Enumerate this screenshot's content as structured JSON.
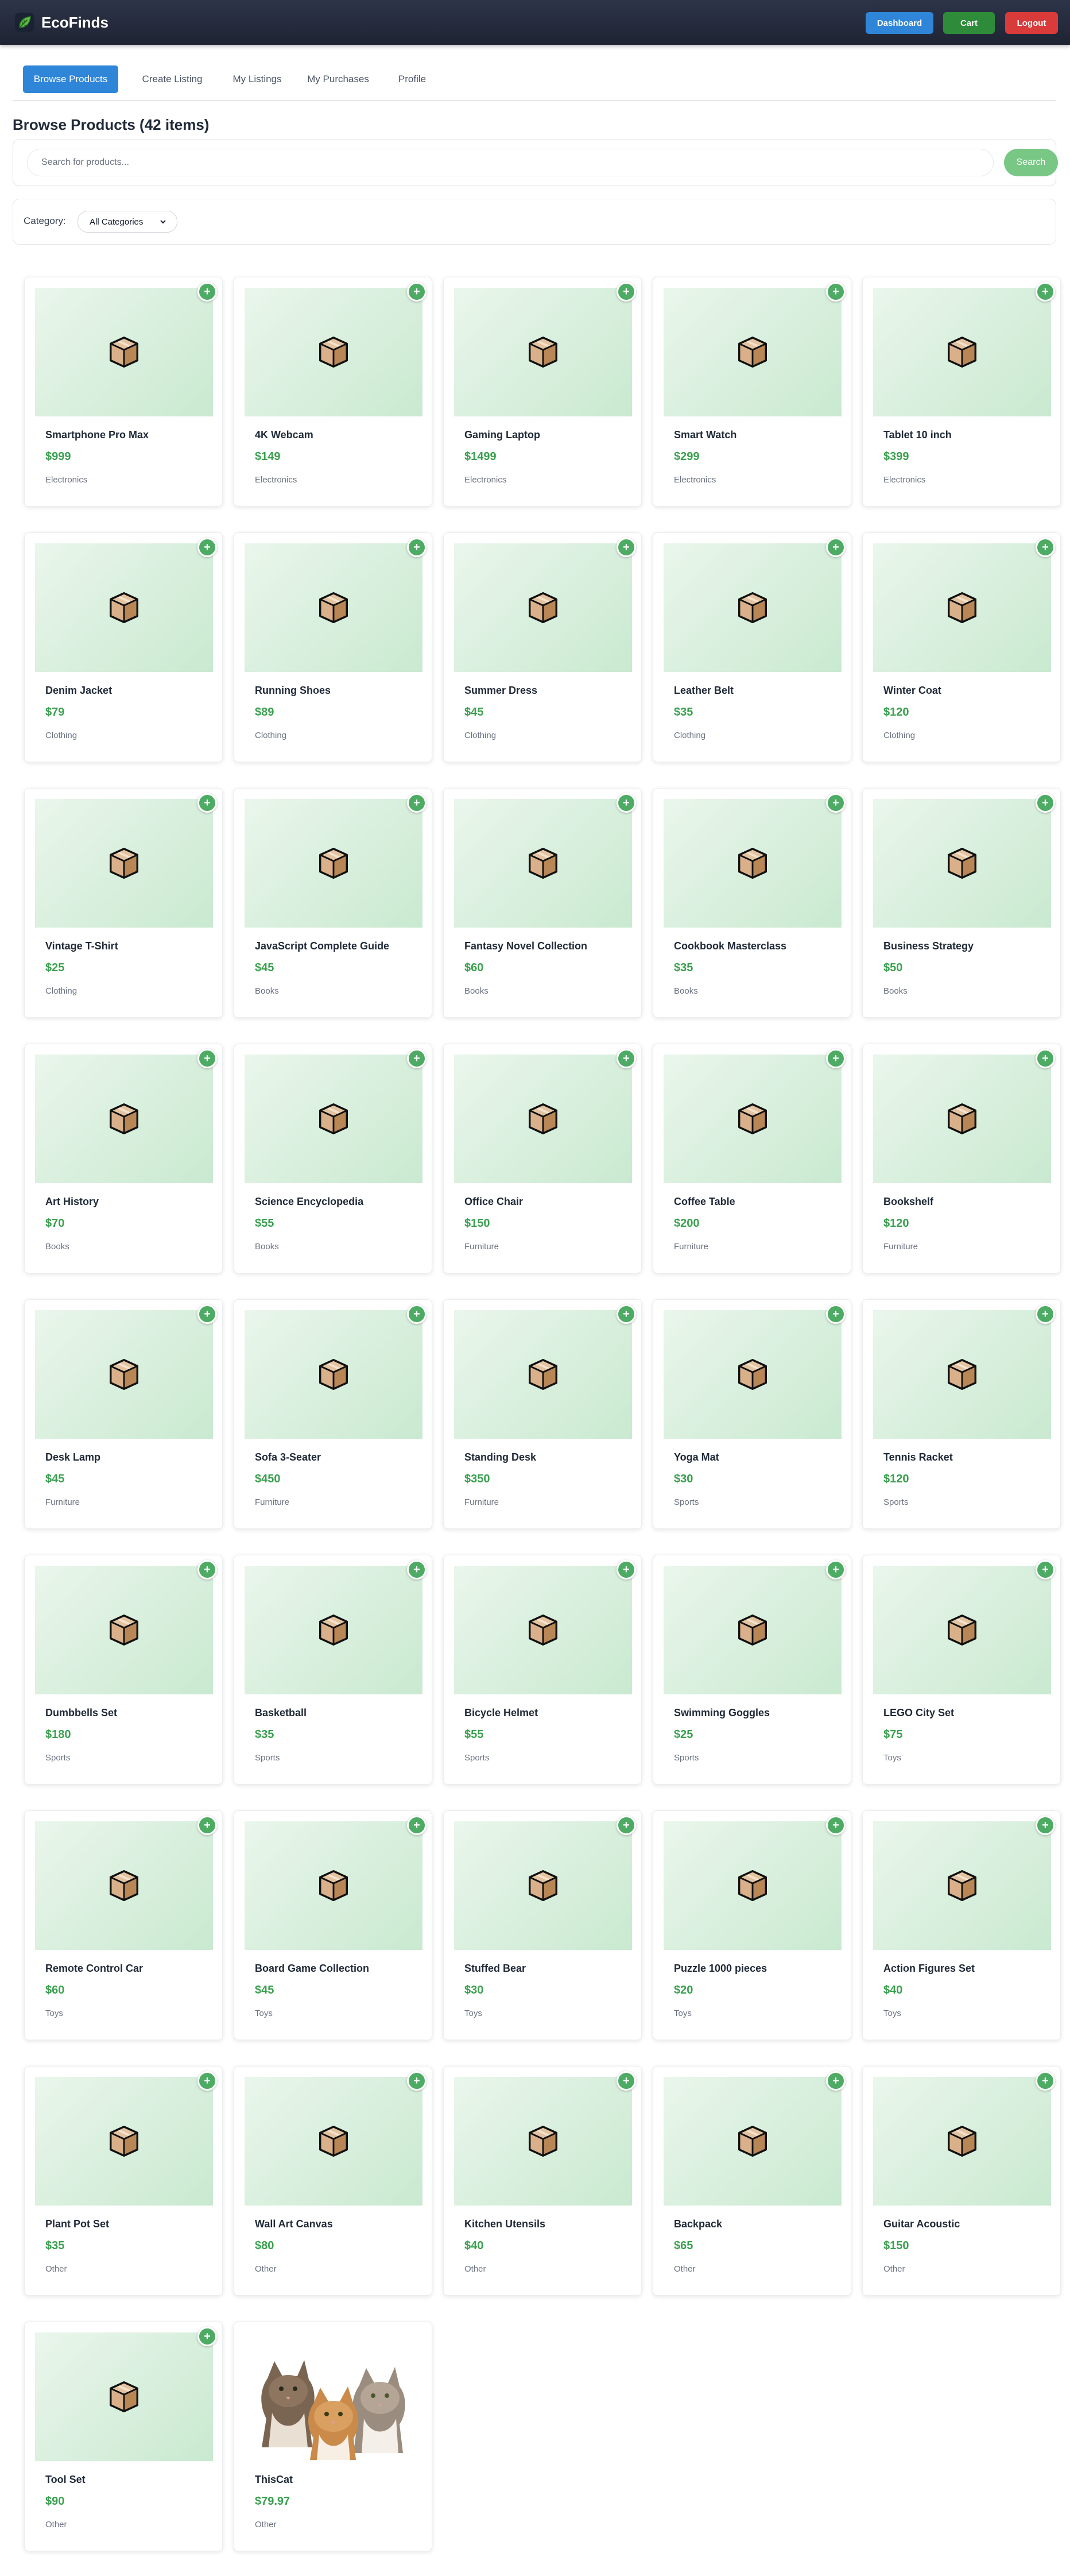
{
  "app": {
    "name": "EcoFinds"
  },
  "header": {
    "dashboard_label": "Dashboard",
    "cart_label": "Cart",
    "logout_label": "Logout"
  },
  "tabs": [
    {
      "label": "Browse Products",
      "active": true
    },
    {
      "label": "Create Listing",
      "active": false
    },
    {
      "label": "My Listings",
      "active": false
    },
    {
      "label": "My Purchases",
      "active": false
    },
    {
      "label": "Profile",
      "active": false
    }
  ],
  "page": {
    "title": "Browse Products (42 items)"
  },
  "search": {
    "placeholder": "Search for products...",
    "button_label": "Search"
  },
  "filter": {
    "label": "Category:",
    "selected": "All Categories"
  },
  "colors": {
    "accent_blue": "#2f86d8",
    "cart_green": "#2e8b3a",
    "logout_red": "#d93a3a",
    "price_green": "#3aa04f"
  },
  "products": [
    {
      "name": "Smartphone Pro Max",
      "price": "$999",
      "category": "Electronics",
      "image": "box-icon"
    },
    {
      "name": "4K Webcam",
      "price": "$149",
      "category": "Electronics",
      "image": "box-icon"
    },
    {
      "name": "Gaming Laptop",
      "price": "$1499",
      "category": "Electronics",
      "image": "box-icon"
    },
    {
      "name": "Smart Watch",
      "price": "$299",
      "category": "Electronics",
      "image": "box-icon"
    },
    {
      "name": "Tablet 10 inch",
      "price": "$399",
      "category": "Electronics",
      "image": "box-icon"
    },
    {
      "name": "Denim Jacket",
      "price": "$79",
      "category": "Clothing",
      "image": "box-icon"
    },
    {
      "name": "Running Shoes",
      "price": "$89",
      "category": "Clothing",
      "image": "box-icon"
    },
    {
      "name": "Summer Dress",
      "price": "$45",
      "category": "Clothing",
      "image": "box-icon"
    },
    {
      "name": "Leather Belt",
      "price": "$35",
      "category": "Clothing",
      "image": "box-icon"
    },
    {
      "name": "Winter Coat",
      "price": "$120",
      "category": "Clothing",
      "image": "box-icon"
    },
    {
      "name": "Vintage T-Shirt",
      "price": "$25",
      "category": "Clothing",
      "image": "box-icon"
    },
    {
      "name": "JavaScript Complete Guide",
      "price": "$45",
      "category": "Books",
      "image": "box-icon"
    },
    {
      "name": "Fantasy Novel Collection",
      "price": "$60",
      "category": "Books",
      "image": "box-icon"
    },
    {
      "name": "Cookbook Masterclass",
      "price": "$35",
      "category": "Books",
      "image": "box-icon"
    },
    {
      "name": "Business Strategy",
      "price": "$50",
      "category": "Books",
      "image": "box-icon"
    },
    {
      "name": "Art History",
      "price": "$70",
      "category": "Books",
      "image": "box-icon"
    },
    {
      "name": "Science Encyclopedia",
      "price": "$55",
      "category": "Books",
      "image": "box-icon"
    },
    {
      "name": "Office Chair",
      "price": "$150",
      "category": "Furniture",
      "image": "box-icon"
    },
    {
      "name": "Coffee Table",
      "price": "$200",
      "category": "Furniture",
      "image": "box-icon"
    },
    {
      "name": "Bookshelf",
      "price": "$120",
      "category": "Furniture",
      "image": "box-icon"
    },
    {
      "name": "Desk Lamp",
      "price": "$45",
      "category": "Furniture",
      "image": "box-icon"
    },
    {
      "name": "Sofa 3-Seater",
      "price": "$450",
      "category": "Furniture",
      "image": "box-icon"
    },
    {
      "name": "Standing Desk",
      "price": "$350",
      "category": "Furniture",
      "image": "box-icon"
    },
    {
      "name": "Yoga Mat",
      "price": "$30",
      "category": "Sports",
      "image": "box-icon"
    },
    {
      "name": "Tennis Racket",
      "price": "$120",
      "category": "Sports",
      "image": "box-icon"
    },
    {
      "name": "Dumbbells Set",
      "price": "$180",
      "category": "Sports",
      "image": "box-icon"
    },
    {
      "name": "Basketball",
      "price": "$35",
      "category": "Sports",
      "image": "box-icon"
    },
    {
      "name": "Bicycle Helmet",
      "price": "$55",
      "category": "Sports",
      "image": "box-icon"
    },
    {
      "name": "Swimming Goggles",
      "price": "$25",
      "category": "Sports",
      "image": "box-icon"
    },
    {
      "name": "LEGO City Set",
      "price": "$75",
      "category": "Toys",
      "image": "box-icon"
    },
    {
      "name": "Remote Control Car",
      "price": "$60",
      "category": "Toys",
      "image": "box-icon"
    },
    {
      "name": "Board Game Collection",
      "price": "$45",
      "category": "Toys",
      "image": "box-icon"
    },
    {
      "name": "Stuffed Bear",
      "price": "$30",
      "category": "Toys",
      "image": "box-icon"
    },
    {
      "name": "Puzzle 1000 pieces",
      "price": "$20",
      "category": "Toys",
      "image": "box-icon"
    },
    {
      "name": "Action Figures Set",
      "price": "$40",
      "category": "Toys",
      "image": "box-icon"
    },
    {
      "name": "Plant Pot Set",
      "price": "$35",
      "category": "Other",
      "image": "box-icon"
    },
    {
      "name": "Wall Art Canvas",
      "price": "$80",
      "category": "Other",
      "image": "box-icon"
    },
    {
      "name": "Kitchen Utensils",
      "price": "$40",
      "category": "Other",
      "image": "box-icon"
    },
    {
      "name": "Backpack",
      "price": "$65",
      "category": "Other",
      "image": "box-icon"
    },
    {
      "name": "Guitar Acoustic",
      "price": "$150",
      "category": "Other",
      "image": "box-icon"
    },
    {
      "name": "Tool Set",
      "price": "$90",
      "category": "Other",
      "image": "box-icon"
    },
    {
      "name": "ThisCat",
      "price": "$79.97",
      "category": "Other",
      "image": "cat-photo"
    }
  ]
}
